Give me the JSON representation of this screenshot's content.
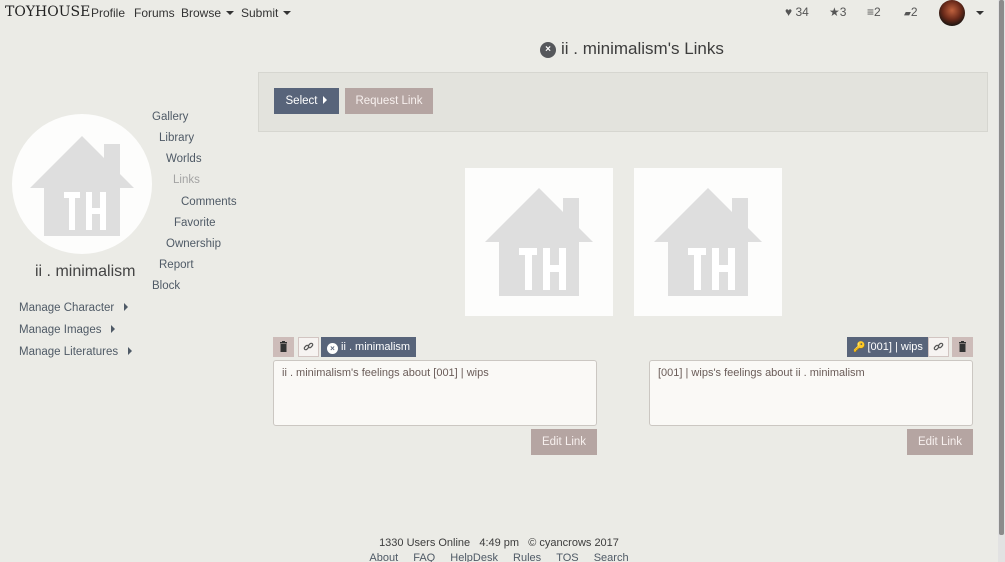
{
  "topnav": {
    "logo": "TOYHOUSE",
    "links": [
      "Profile",
      "Forums",
      "Browse",
      "Submit"
    ],
    "stats": {
      "favorites": "34",
      "stars": "3",
      "lists": "2",
      "messages": "2"
    }
  },
  "page": {
    "title_icon": "×",
    "title": "ii . minimalism's Links"
  },
  "sidebar": {
    "character_name": "ii . minimalism",
    "nav": [
      "Gallery",
      "Library",
      "Worlds",
      "Links",
      "Comments",
      "Favorite",
      "Ownership",
      "Report",
      "Block"
    ],
    "active": "Links",
    "manage": [
      "Manage Character",
      "Manage Images",
      "Manage Literatures"
    ]
  },
  "toolbar": {
    "select_label": "Select",
    "request_label": "Request Link"
  },
  "link": {
    "left_chip": "ii . minimalism",
    "right_chip": "[001] | wips",
    "left_text": "ii . minimalism's feelings about [001] | wips",
    "right_text": "[001] | wips's feelings about ii . minimalism",
    "edit_label": "Edit Link"
  },
  "footer": {
    "users_online": "1330 Users Online",
    "time": "4:49 pm",
    "copyright": "© cyancrows 2017",
    "links": [
      "About",
      "FAQ",
      "HelpDesk",
      "Rules",
      "TOS",
      "Search"
    ]
  },
  "colors": {
    "background": "#ebebe6",
    "primary_button": "#58647a",
    "muted_button": "#b5a5a2",
    "link": "#4f5a66"
  }
}
